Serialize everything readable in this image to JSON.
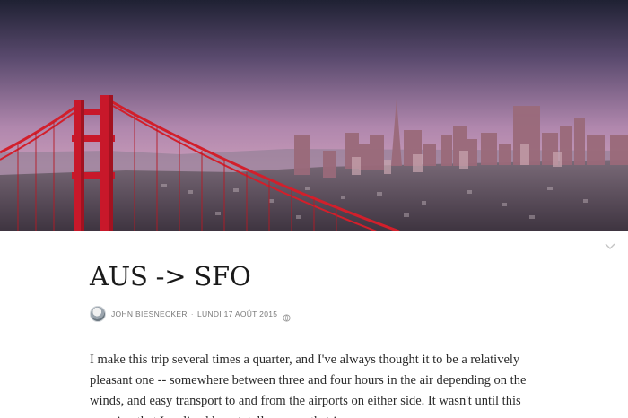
{
  "post": {
    "title": "AUS -> SFO",
    "author": "JOHN BIESNECKER",
    "separator": "·",
    "date": "LUNDI 17 AOÛT 2015",
    "body": "I make this trip several times a quarter, and I've always thought it to be a relatively pleasant one -- somewhere between three and four hours in the air depending on the winds, and easy transport to and from the airports on either side. It wasn't until this morning that I realized how totally wrong that is."
  },
  "colors": {
    "accent": "#d21f2b",
    "sky_top": "#2a2a3e",
    "sky_bottom": "#c68fb8",
    "text": "#2b2b2b"
  },
  "icons": {
    "collapse": "chevron-down-icon",
    "privacy": "globe-icon",
    "avatar": "avatar"
  }
}
